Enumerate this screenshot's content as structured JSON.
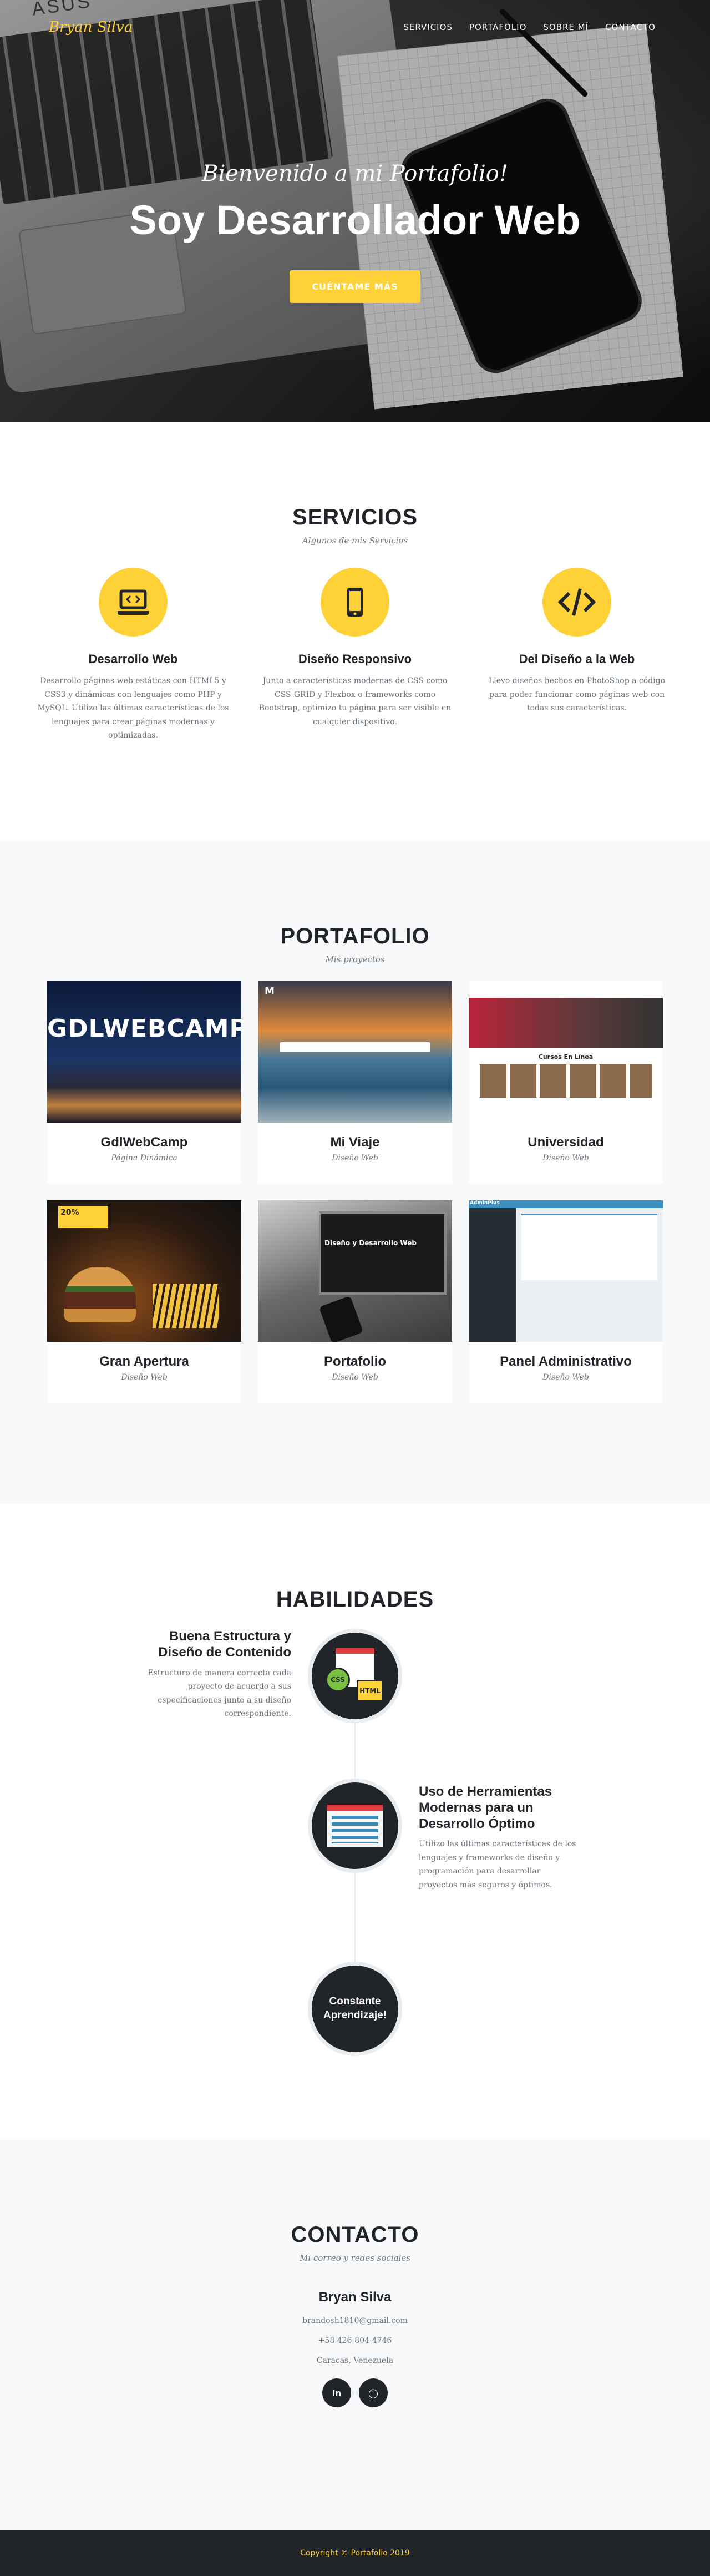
{
  "nav": {
    "brand": "Bryan Silva",
    "items": [
      "SERVICIOS",
      "PORTAFOLIO",
      "SOBRE MÍ",
      "CONTACTO"
    ]
  },
  "hero": {
    "subtitle": "Bienvenido a mi Portafolio!",
    "title": "Soy Desarrollador Web",
    "cta": "CUÉNTAME MÁS",
    "laptop_brand": "ASUS"
  },
  "services": {
    "title": "SERVICIOS",
    "subtitle": "Algunos de mis Servicios",
    "items": [
      {
        "title": "Desarrollo Web",
        "text": "Desarrollo páginas web estáticas con HTML5 y CSS3 y dinámicas con lenguajes como PHP y MySQL. Utilizo las últimas características de los lenguajes para crear páginas modernas y optimizadas.",
        "icon": "laptop-code-icon"
      },
      {
        "title": "Diseño Responsivo",
        "text": "Junto a características modernas de CSS como CSS-GRID y Flexbox o frameworks como Bootstrap, optimizo tu página para ser visible en cualquier dispositivo.",
        "icon": "mobile-icon"
      },
      {
        "title": "Del Diseño a la Web",
        "text": "Llevo diseños hechos en PhotoShop a código para poder funcionar como páginas web con todas sus características.",
        "icon": "code-icon"
      }
    ]
  },
  "portfolio": {
    "title": "PORTAFOLIO",
    "subtitle": "Mis proyectos",
    "items": [
      {
        "title": "GdlWebCamp",
        "subtitle": "Página Dinámica",
        "img_text": "GDLWEBCAMP"
      },
      {
        "title": "Mi Viaje",
        "subtitle": "Diseño Web",
        "img_text": "M"
      },
      {
        "title": "Universidad",
        "subtitle": "Diseño Web",
        "img_text": "Cursos En Línea"
      },
      {
        "title": "Gran Apertura",
        "subtitle": "Diseño Web",
        "img_text": "20%"
      },
      {
        "title": "Portafolio",
        "subtitle": "Diseño Web",
        "img_text": "Diseño y Desarrollo Web"
      },
      {
        "title": "Panel Administrativo",
        "subtitle": "Diseño Web",
        "img_text": "AdminPlus"
      }
    ]
  },
  "skills": {
    "title": "HABILIDADES",
    "items": [
      {
        "title": "Buena Estructura y Diseño de Contenido",
        "text": "Estructuro de manera correcta cada proyecto de acuerdo a sus especificaciones junto a su diseño correspondiente.",
        "icon_a": "CSS",
        "icon_b": "HTML"
      },
      {
        "title": "Uso de Herramientas Modernas para un Desarrollo Óptimo",
        "text": "Utilizo las últimas características de los lenguajes y frameworks de diseño y programación para desarrollar proyectos más seguros y óptimos."
      },
      {
        "title": "Constante Aprendizaje!"
      }
    ]
  },
  "contact": {
    "title": "CONTACTO",
    "subtitle": "Mi correo y redes sociales",
    "name": "Bryan Silva",
    "email": "brandosh1810@gmail.com",
    "phone": "+58 426-804-4746",
    "location": "Caracas, Venezuela",
    "socials": [
      {
        "label": "in",
        "icon": "linkedin-icon"
      },
      {
        "label": "◯",
        "icon": "github-icon"
      }
    ]
  },
  "footer": {
    "text": "Copyright © Portafolio 2019"
  },
  "colors": {
    "accent": "#fed136",
    "dark": "#212529",
    "muted": "#6c757d",
    "light_bg": "#f8f9fa"
  }
}
